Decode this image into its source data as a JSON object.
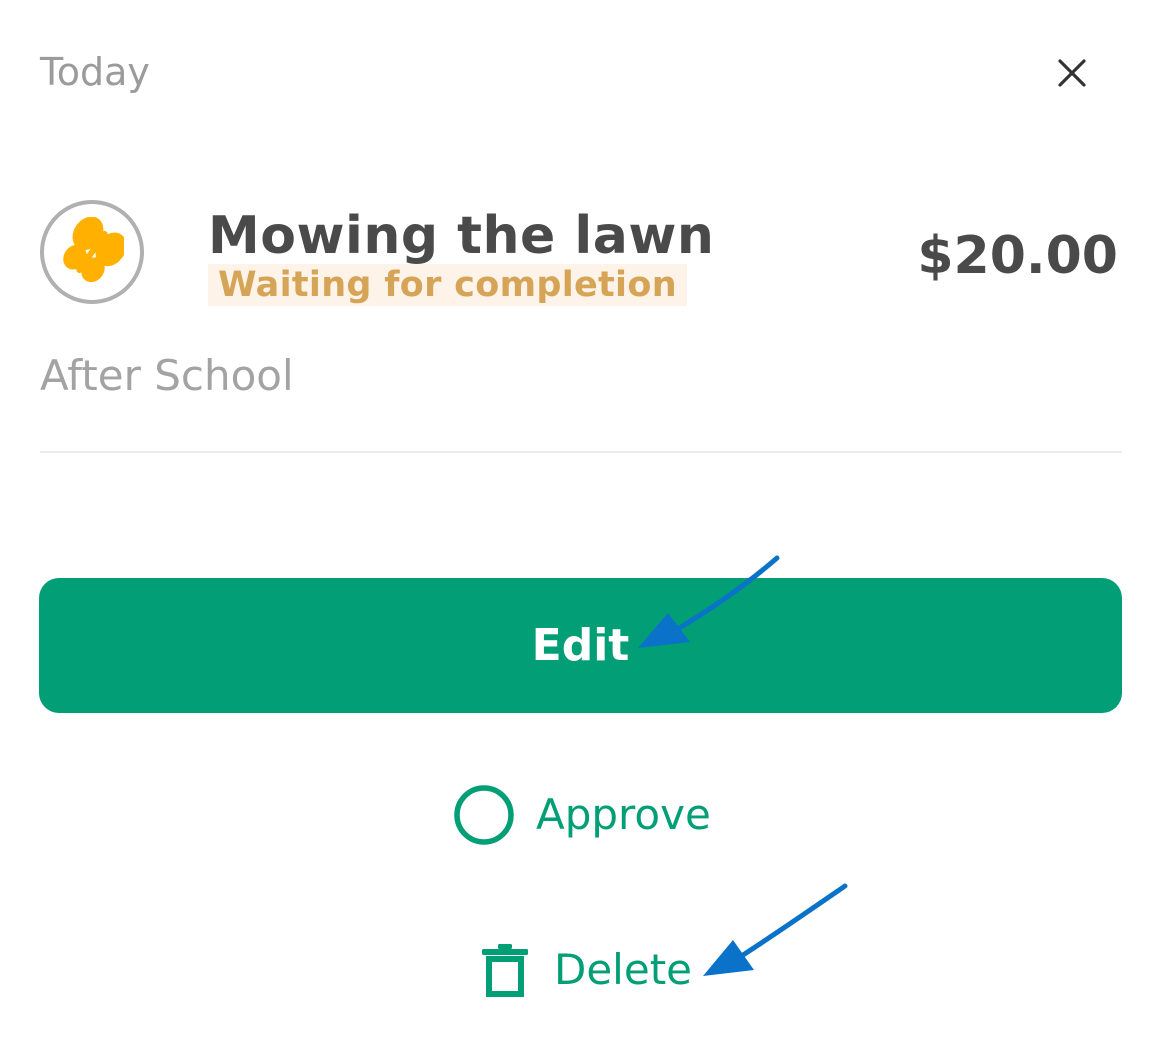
{
  "header": {
    "date_label": "Today",
    "close_icon": "close-icon"
  },
  "chore": {
    "avatar_icon": "butterfly-icon",
    "avatar_color": "#ffb000",
    "title": "Mowing the lawn",
    "status": "Waiting for completion",
    "amount": "$20.00",
    "time_slot": "After School"
  },
  "actions": {
    "edit_label": "Edit",
    "approve_label": "Approve",
    "approve_icon": "circle-outline-icon",
    "delete_label": "Delete",
    "delete_icon": "trash-icon"
  },
  "colors": {
    "accent": "#029e76",
    "status_text": "#d6a456",
    "status_bg": "#fdf3e8",
    "annotation_arrow": "#0a72c9"
  }
}
